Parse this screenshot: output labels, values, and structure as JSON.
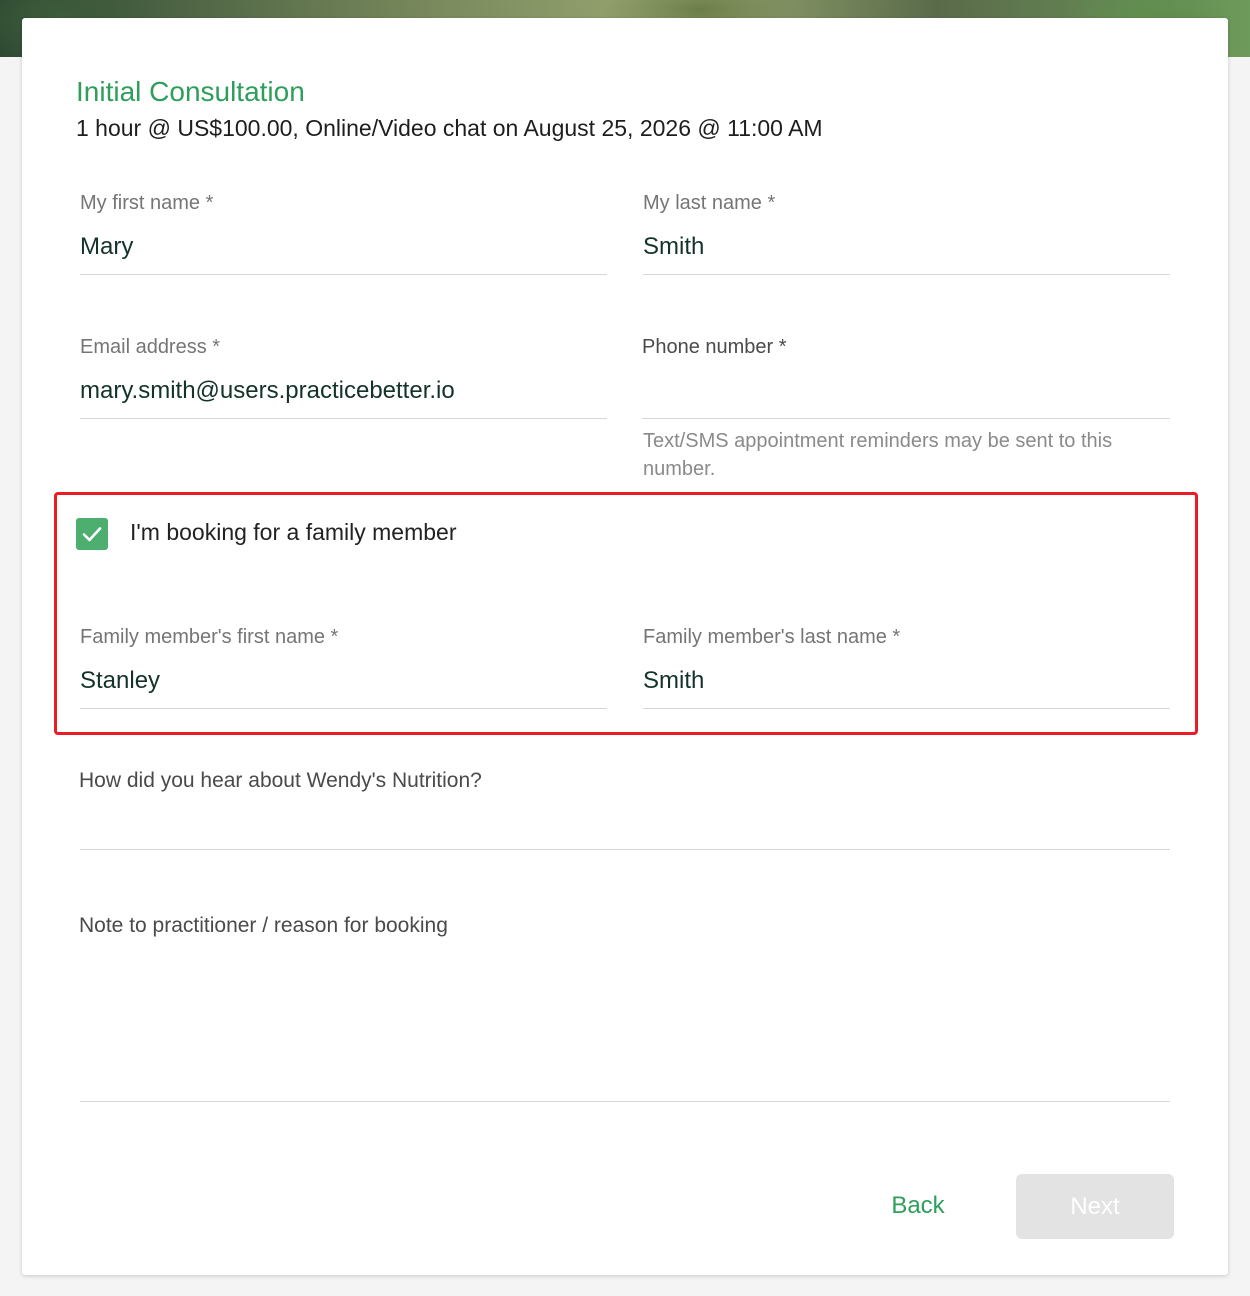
{
  "booking": {
    "title": "Initial Consultation",
    "subtitle": "1 hour @ US$100.00, Online/Video chat on August 25, 2026 @ 11:00 AM"
  },
  "form": {
    "first_name": {
      "label": "My first name *",
      "value": "Mary"
    },
    "last_name": {
      "label": "My last name *",
      "value": "Smith"
    },
    "email": {
      "label": "Email address *",
      "value": "mary.smith@users.practicebetter.io"
    },
    "phone": {
      "label": "Phone number *",
      "value": "",
      "hint": "Text/SMS appointment reminders may be sent to this number."
    },
    "family_checkbox": {
      "label": "I'm booking for a family member",
      "checked": true
    },
    "family_first_name": {
      "label": "Family member's first name *",
      "value": "Stanley"
    },
    "family_last_name": {
      "label": "Family member's last name *",
      "value": "Smith"
    },
    "referral": {
      "label": "How did you hear about Wendy's Nutrition?",
      "value": ""
    },
    "note": {
      "label": "Note to practitioner / reason for booking",
      "value": ""
    }
  },
  "actions": {
    "back_label": "Back",
    "next_label": "Next"
  },
  "colors": {
    "accent": "#2e9e5b",
    "checkbox": "#4caf6f",
    "highlight": "#ec1c24",
    "disabled_button": "#e3e3e3"
  }
}
